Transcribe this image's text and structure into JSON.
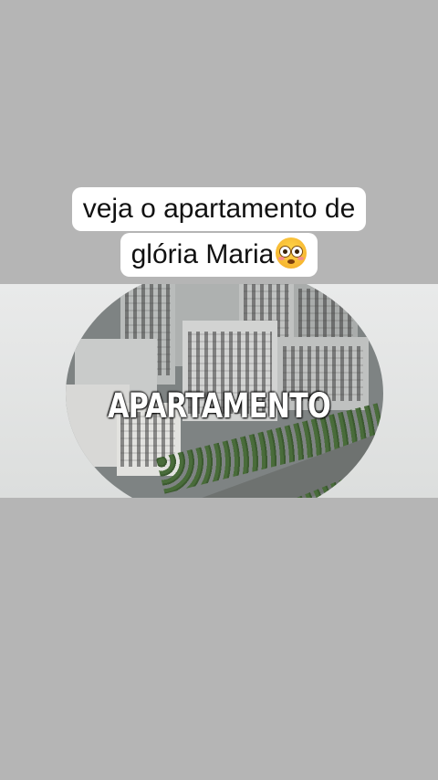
{
  "caption": {
    "line1": "veja o apartamento de",
    "line2": "glória Maria",
    "emoji": "flushed-face-emoji"
  },
  "video": {
    "overlay_text": "APARTAMENTO"
  },
  "colors": {
    "background": "#b5b5b5",
    "caption_bg": "#ffffff",
    "caption_text": "#111111",
    "overlay_text": "#ffffff"
  }
}
